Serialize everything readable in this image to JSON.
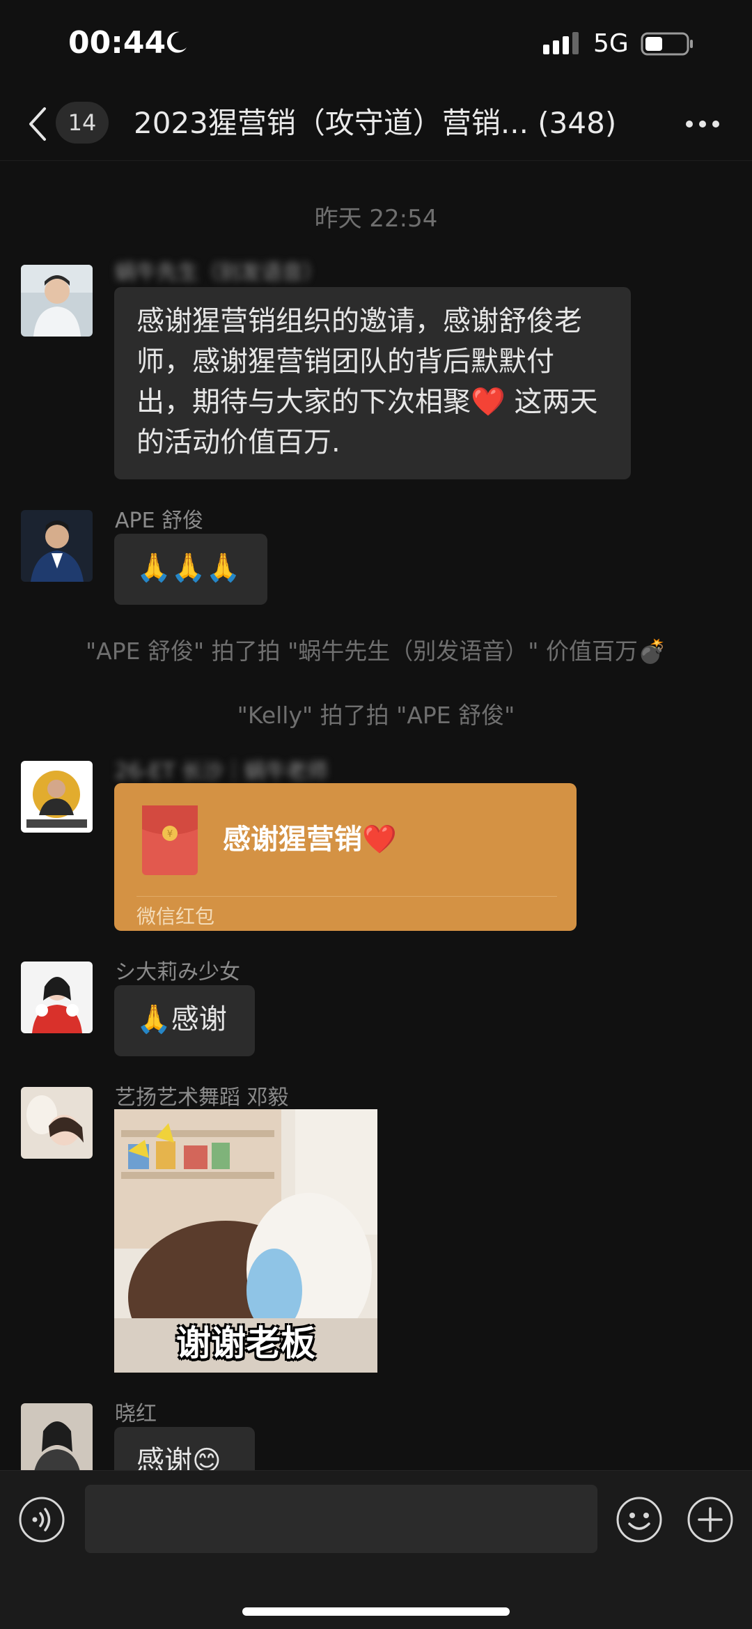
{
  "status_bar": {
    "time": "00:44",
    "network": "5G"
  },
  "nav": {
    "unread_count": "14",
    "title": "2023猩营销（攻守道）营销... (348)"
  },
  "chat": {
    "time_separator": "昨天 22:54",
    "msg1": {
      "sender": "蜗牛先生（别发语音）",
      "text": "感谢猩营销组织的邀请，感谢舒俊老师，感谢猩营销团队的背后默默付出，期待与大家的下次相聚❤️ 这两天的活动价值百万."
    },
    "msg2": {
      "sender": "APE 舒俊",
      "text": "🙏🙏🙏"
    },
    "system1": "\"APE 舒俊\" 拍了拍 \"蜗牛先生（别发语音）\" 价值百万💣",
    "system2": "\"Kelly\" 拍了拍 \"APE 舒俊\"",
    "msg3": {
      "sender": "26-ET 长沙｜蜗牛老师",
      "red_packet_title": "感谢猩营销❤️",
      "red_packet_label": "微信红包"
    },
    "msg4": {
      "sender": "シ大莉み少女",
      "text": "🙏感谢"
    },
    "msg5": {
      "sender": "艺扬艺术舞蹈 邓毅",
      "sticker_caption": "谢谢老板"
    },
    "msg6": {
      "sender": "晓红",
      "text": "感谢😊"
    }
  },
  "colors": {
    "background": "#111111",
    "bubble": "#2c2c2c",
    "red_packet": "#D49244"
  }
}
